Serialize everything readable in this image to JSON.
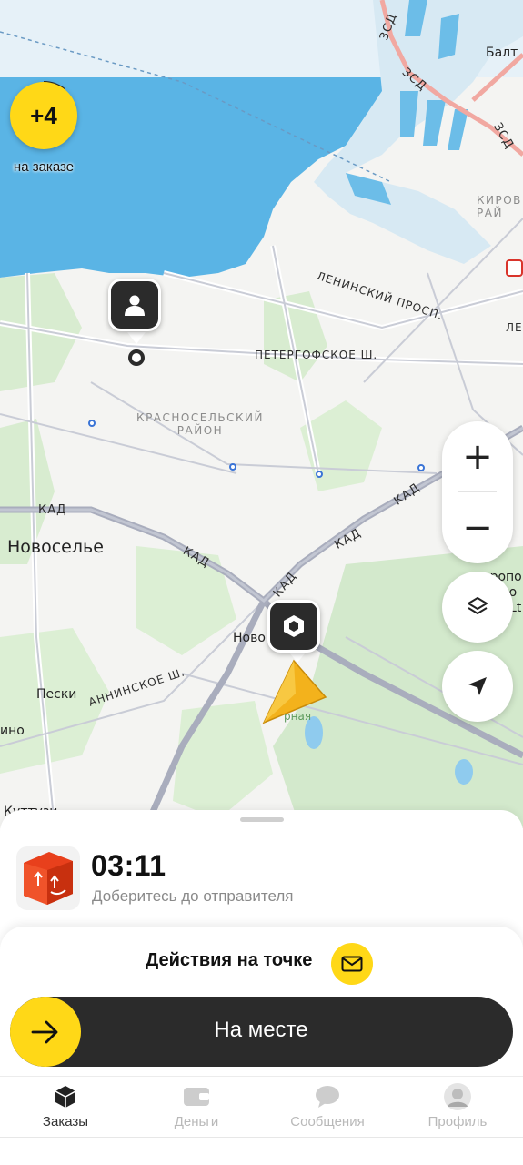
{
  "map": {
    "labels": {
      "kad_1": "КАД",
      "kad_2": "КАД",
      "kad_3": "КАД",
      "kad_4": "КАД",
      "kad_5": "КАД",
      "zsd_1": "ЗСД",
      "zsd_2": "ЗСД",
      "zsd_3": "ЗСД",
      "leninsky": "ЛЕНИНСКИЙ ПРОСП.",
      "petergof": "ПЕТЕРГОФСКОЕ Ш.",
      "anninskoe": "АННИНСКОЕ Ш.",
      "district_line1": "КРАСНОСЕЛЬСКИЙ",
      "district_line2": "РАЙОН",
      "kirov_line1": "КИРОВ",
      "kirov_line2": "РАЙ",
      "le": "ЛЕ",
      "novoselie": "Новоселье",
      "peski": "Пески",
      "novo": "Ново",
      "ino": "ино",
      "kuttuzi": "Куттузи",
      "balt": "Балт",
      "oropol": "оропо",
      "nko": "нко",
      "li": "Lt",
      "ozernaya": "рная"
    }
  },
  "order_badge": {
    "count": "+4",
    "caption": "на заказе"
  },
  "markers": {
    "sender": "person-icon",
    "package": "box-icon",
    "courier": "navigation-arrow-icon"
  },
  "map_controls": {
    "zoom_in": "+",
    "zoom_out": "−",
    "layers": "layers-icon",
    "locate": "locate-arrow-icon"
  },
  "order": {
    "timer": "03:11",
    "instruction": "Доберитесь до отправителя"
  },
  "actions": {
    "title": "Действия на точке",
    "slider_label": "На месте"
  },
  "tabs": [
    {
      "label": "Заказы",
      "icon": "orders-box-icon",
      "active": true
    },
    {
      "label": "Деньги",
      "icon": "wallet-icon",
      "active": false
    },
    {
      "label": "Сообщения",
      "icon": "chat-icon",
      "active": false
    },
    {
      "label": "Профиль",
      "icon": "avatar",
      "active": false
    }
  ],
  "colors": {
    "accent": "#ffd817",
    "dark": "#2b2b2b",
    "water": "#5ab4e5",
    "land": "#f5f5f3",
    "green": "#d8ecd0"
  }
}
